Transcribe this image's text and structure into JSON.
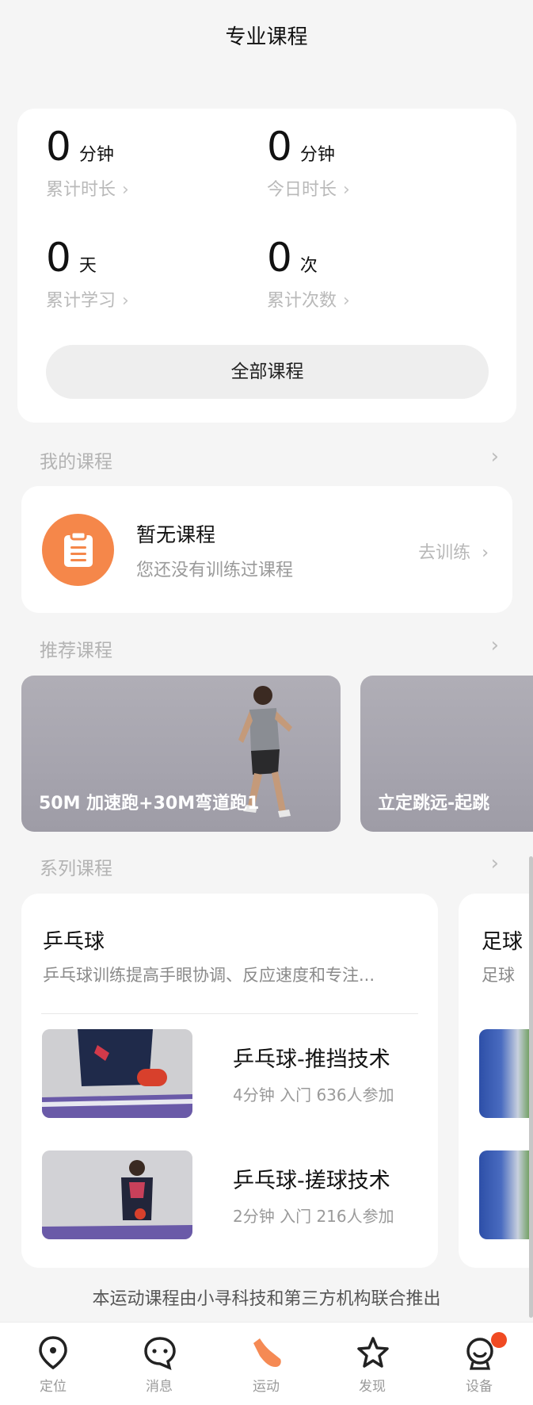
{
  "header": {
    "title": "专业课程"
  },
  "stats": {
    "total_duration": {
      "value": "0",
      "unit": "分钟",
      "label": "累计时长"
    },
    "today_duration": {
      "value": "0",
      "unit": "分钟",
      "label": "今日时长"
    },
    "total_days": {
      "value": "0",
      "unit": "天",
      "label": "累计学习"
    },
    "total_count": {
      "value": "0",
      "unit": "次",
      "label": "累计次数"
    },
    "chevron": "›",
    "all_courses_button": "全部课程"
  },
  "my_courses": {
    "section_title": "我的课程",
    "empty_title": "暂无课程",
    "empty_subtitle": "您还没有训练过课程",
    "go_train": "去训练",
    "icon": "clipboard-icon"
  },
  "recommended": {
    "section_title": "推荐课程",
    "cards": [
      {
        "title": "50M 加速跑+30M弯道跑1"
      },
      {
        "title": "立定跳远-起跳"
      }
    ]
  },
  "series": {
    "section_title": "系列课程",
    "cards": [
      {
        "title": "乒乓球",
        "description": "乒乓球训练提高手眼协调、反应速度和专注...",
        "lessons": [
          {
            "name": "乒乓球-推挡技术",
            "meta": "4分钟   入门  636人参加"
          },
          {
            "name": "乒乓球-搓球技术",
            "meta": "2分钟   入门  216人参加"
          }
        ]
      },
      {
        "title": "足球",
        "description": "足球"
      }
    ]
  },
  "footer_note": "本运动课程由小寻科技和第三方机构联合推出",
  "tabbar": {
    "items": [
      {
        "label": "定位",
        "icon": "location-icon"
      },
      {
        "label": "消息",
        "icon": "message-icon"
      },
      {
        "label": "运动",
        "icon": "sport-shoe-icon"
      },
      {
        "label": "发现",
        "icon": "star-icon"
      },
      {
        "label": "设备",
        "icon": "device-icon"
      }
    ],
    "active_color": "#f58a54",
    "badge_color": "#f04a22"
  }
}
